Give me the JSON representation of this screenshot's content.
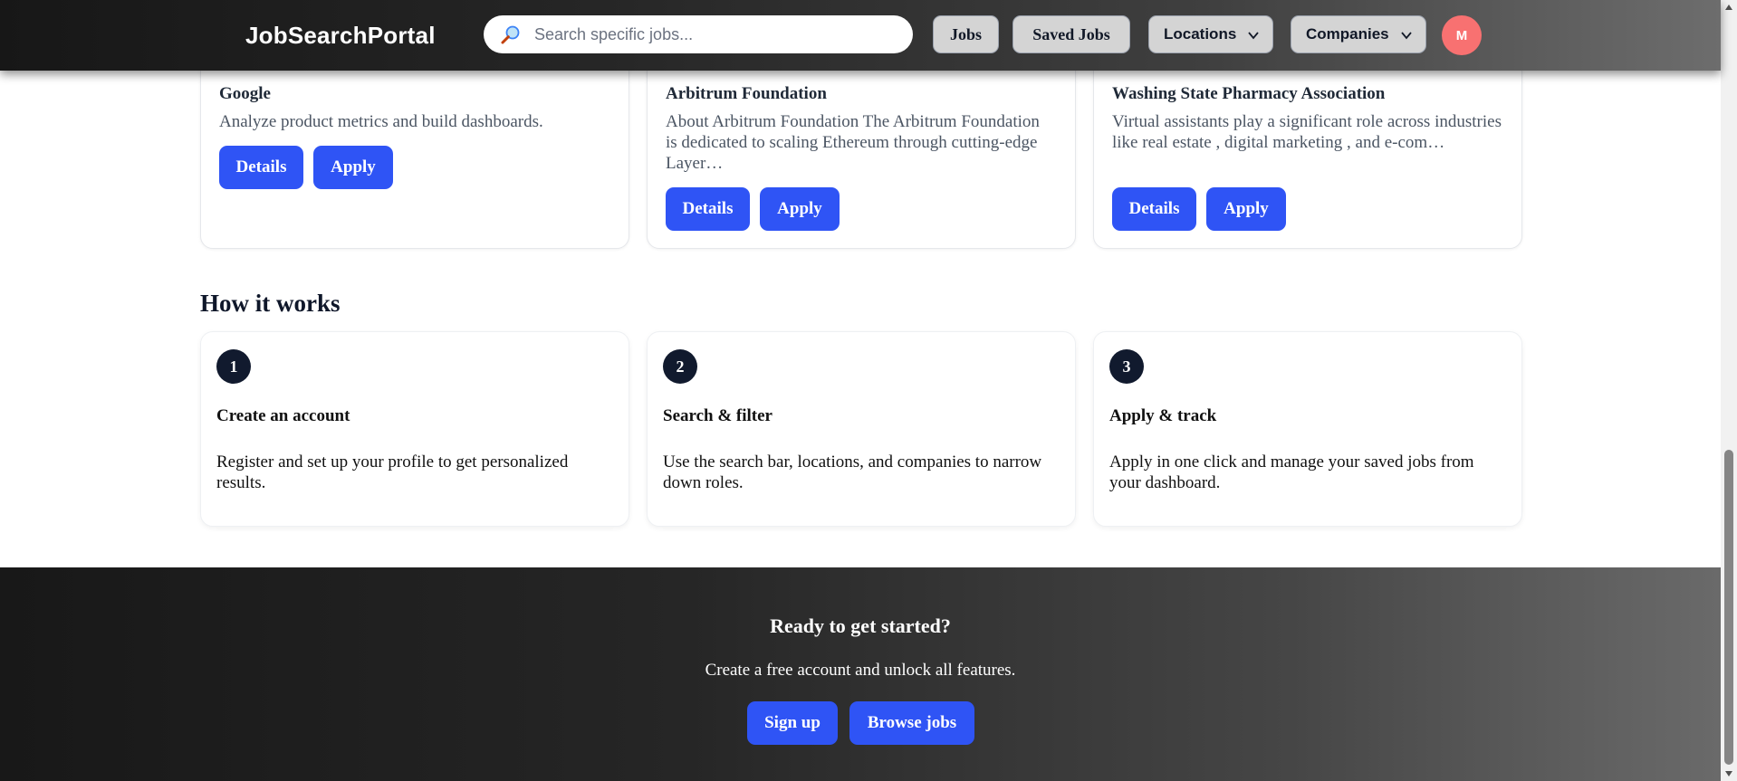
{
  "header": {
    "logo": "JobSearchPortal",
    "search_placeholder": "Search specific jobs...",
    "search_icon": "magnifier-icon",
    "nav": {
      "jobs": "Jobs",
      "saved_jobs": "Saved Jobs",
      "locations": "Locations",
      "companies": "Companies"
    },
    "avatar_initial": "M"
  },
  "jobs": [
    {
      "company": "Google",
      "description": "Analyze product metrics and build dashboards.",
      "details_label": "Details",
      "apply_label": "Apply"
    },
    {
      "company": "Arbitrum Foundation",
      "description": "About Arbitrum Foundation The Arbitrum Foundation is dedicated to scaling Ethereum through cutting-edge Layer…",
      "details_label": "Details",
      "apply_label": "Apply"
    },
    {
      "company": "Washing State Pharmacy Association",
      "description": "Virtual assistants play a significant role across industries like real estate , digital marketing , and e-com…",
      "details_label": "Details",
      "apply_label": "Apply"
    }
  ],
  "how_it_works": {
    "title": "How it works",
    "steps": [
      {
        "number": "1",
        "title": "Create an account",
        "description": "Register and set up your profile to get personalized results."
      },
      {
        "number": "2",
        "title": "Search & filter",
        "description": "Use the search bar, locations, and companies to narrow down roles."
      },
      {
        "number": "3",
        "title": "Apply & track",
        "description": "Apply in one click and manage your saved jobs from your dashboard."
      }
    ]
  },
  "cta": {
    "title": "Ready to get started?",
    "subtitle": "Create a free account and unlock all features.",
    "signup_label": "Sign up",
    "browse_label": "Browse jobs"
  },
  "colors": {
    "primary_button": "#2f54f5",
    "avatar": "#f87171",
    "step_badge": "#111a2e"
  }
}
